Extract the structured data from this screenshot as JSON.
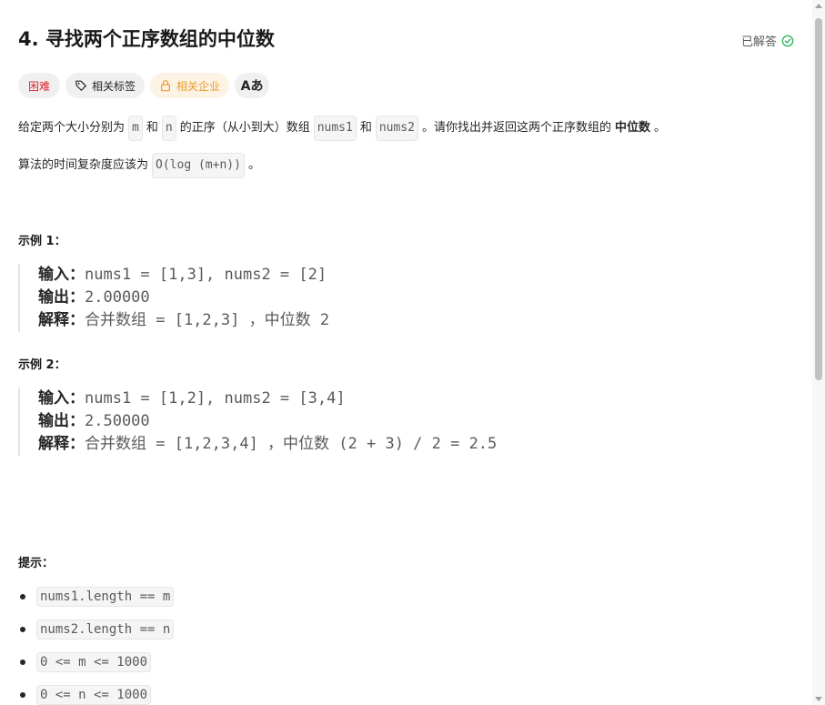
{
  "problem": {
    "title": "4. 寻找两个正序数组的中位数",
    "status": "已解答",
    "status_color": "#2db55d"
  },
  "tags": {
    "difficulty": "困难",
    "related_tags": "相关标签",
    "related_companies": "相关企业",
    "lang_icon": "Aあ"
  },
  "description": {
    "p1_a": "给定两个大小分别为",
    "p1_m": "m",
    "p1_b": "和",
    "p1_n": "n",
    "p1_c": "的正序（从小到大）数组",
    "p1_nums1": "nums1",
    "p1_d": "和",
    "p1_nums2": "nums2",
    "p1_e": "。请你找出并返回这两个正序数组的",
    "p1_bold": "中位数",
    "p1_f": "。",
    "p2_a": "算法的时间复杂度应该为",
    "p2_code": "O(log (m+n))",
    "p2_b": "。"
  },
  "example1": {
    "title": "示例 1：",
    "input_label": "输入：",
    "input": "nums1 = [1,3], nums2 = [2]",
    "output_label": "输出：",
    "output": "2.00000",
    "explain_label": "解释：",
    "explain": "合并数组 = [1,2,3] ，中位数 2"
  },
  "example2": {
    "title": "示例 2：",
    "input_label": "输入：",
    "input": "nums1 = [1,2], nums2 = [3,4]",
    "output_label": "输出：",
    "output": "2.50000",
    "explain_label": "解释：",
    "explain": "合并数组 = [1,2,3,4] ，中位数 (2 + 3) / 2 = 2.5"
  },
  "hints": {
    "title": "提示：",
    "items": [
      "nums1.length == m",
      "nums2.length == n",
      "0 <= m <= 1000",
      "0 <= n <= 1000"
    ]
  }
}
